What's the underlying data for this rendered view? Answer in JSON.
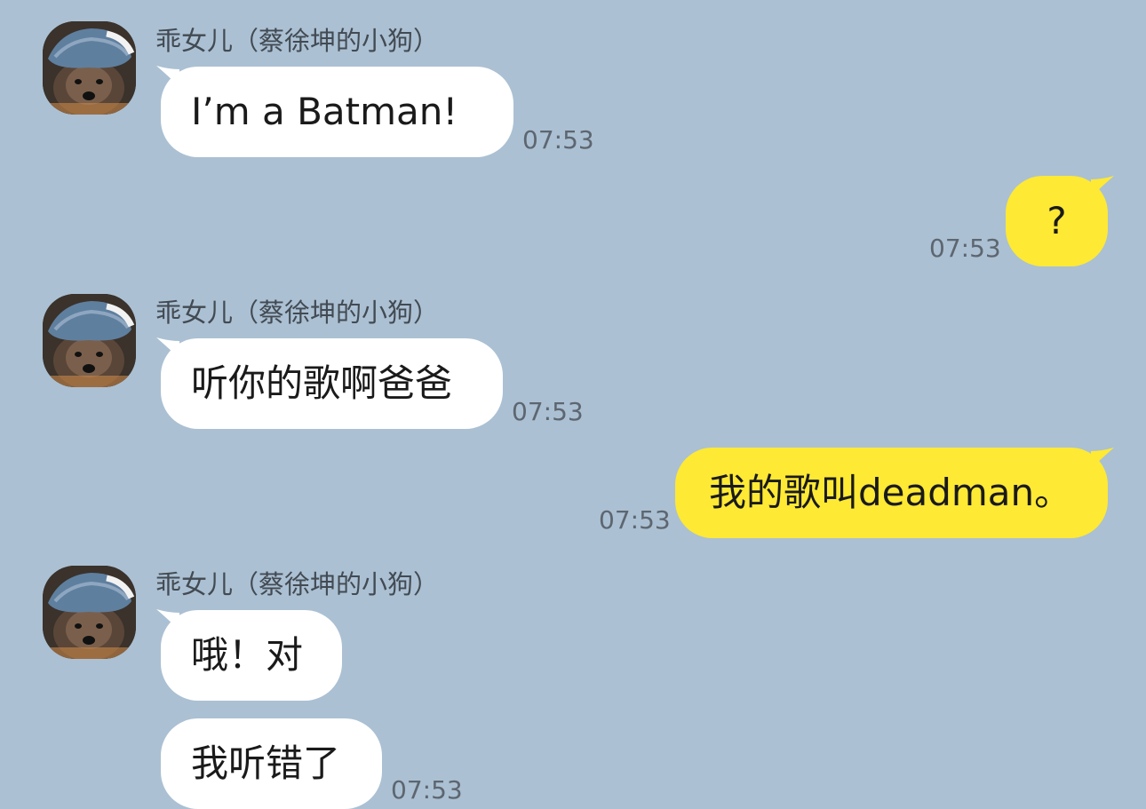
{
  "chat": {
    "background_color": "#abc0d3",
    "incoming_bubble_color": "#ffffff",
    "outgoing_bubble_color": "#fee934",
    "messages": [
      {
        "direction": "incoming",
        "sender": "乖女儿（蔡徐坤的小狗）",
        "text": "I’m a Batman!",
        "time": "07:53"
      },
      {
        "direction": "outgoing",
        "text": "?",
        "time": "07:53"
      },
      {
        "direction": "incoming",
        "sender": "乖女儿（蔡徐坤的小狗）",
        "text": "听你的歌啊爸爸",
        "time": "07:53"
      },
      {
        "direction": "outgoing",
        "text": "我的歌叫deadman。",
        "time": "07:53"
      },
      {
        "direction": "incoming",
        "sender": "乖女儿（蔡徐坤的小狗）",
        "text": "哦！对"
      },
      {
        "direction": "incoming",
        "text": "我听错了",
        "time": "07:53"
      }
    ]
  },
  "avatar_icon": "dog-wearing-denim-cap-avatar-icon"
}
